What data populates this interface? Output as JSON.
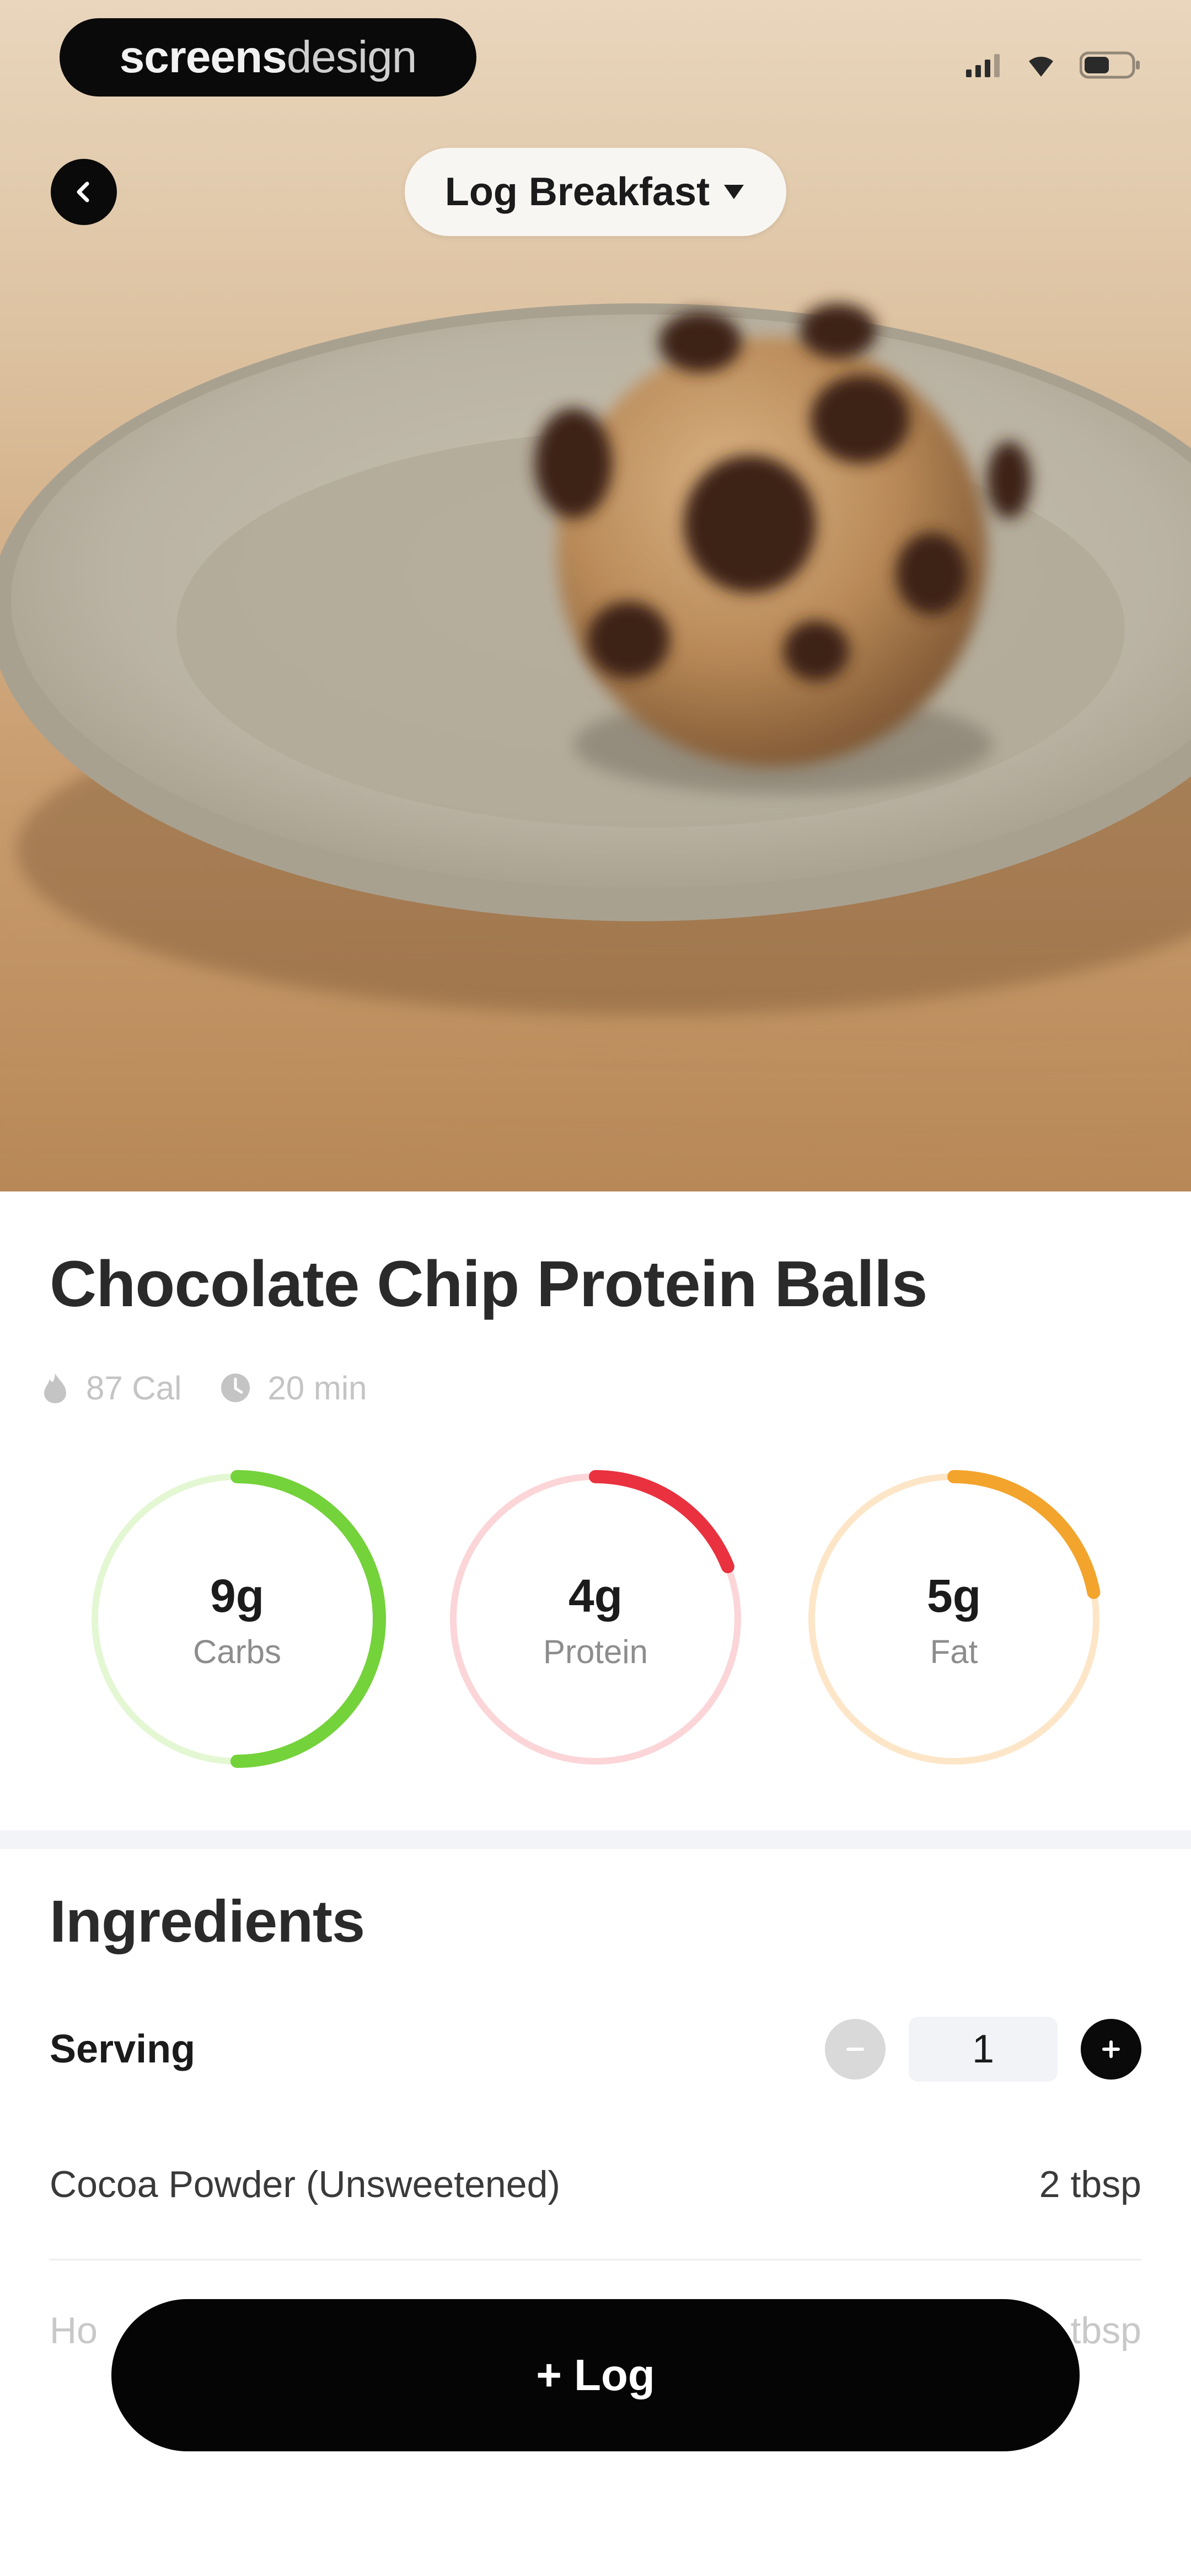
{
  "status_bar": {
    "brand_part1": "screens",
    "brand_part2": "design",
    "icons": [
      "cellular-signal-icon",
      "wifi-icon",
      "battery-icon"
    ]
  },
  "header": {
    "back_icon": "chevron-left-icon",
    "meal_selector_label": "Log Breakfast",
    "meal_selector_icon": "caret-down-icon"
  },
  "hero": {
    "image_subject": "chocolate chip protein ball on a ceramic plate"
  },
  "recipe": {
    "title": "Chocolate Chip Protein Balls",
    "calories": "87 Cal",
    "time": "20 min",
    "calories_icon": "flame-icon",
    "time_icon": "clock-icon"
  },
  "macros": [
    {
      "value": "9g",
      "label": "Carbs",
      "color": "#74d23a",
      "track": "#e3f7d3",
      "fraction": 0.5
    },
    {
      "value": "4g",
      "label": "Protein",
      "color": "#e9313f",
      "track": "#fbd5d7",
      "fraction": 0.19
    },
    {
      "value": "5g",
      "label": "Fat",
      "color": "#f3a42c",
      "track": "#fde6c8",
      "fraction": 0.22
    }
  ],
  "ingredients": {
    "title": "Ingredients",
    "serving_label": "Serving",
    "serving_qty": "1",
    "items": [
      {
        "name": "Cocoa Powder (Unsweetened)",
        "amount": "2 tbsp"
      },
      {
        "name": "Ho",
        "amount": "tbsp"
      }
    ]
  },
  "log_button": {
    "label": "+ Log"
  }
}
